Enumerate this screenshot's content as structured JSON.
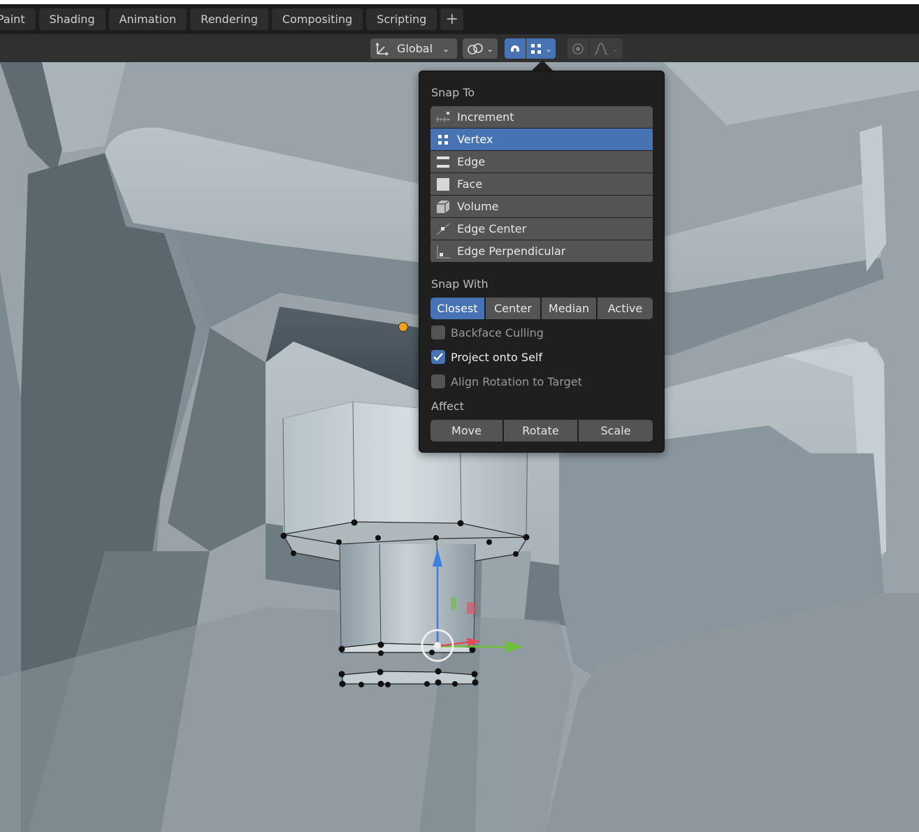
{
  "workspace_tabs": [
    "Paint",
    "Shading",
    "Animation",
    "Rendering",
    "Compositing",
    "Scripting"
  ],
  "workspace_add": "+",
  "header": {
    "orientation_label": "Global"
  },
  "snap_popover": {
    "snap_to_label": "Snap To",
    "snap_to_items": [
      {
        "label": "Increment",
        "icon": "increment-icon",
        "selected": false
      },
      {
        "label": "Vertex",
        "icon": "vertex-icon",
        "selected": true
      },
      {
        "label": "Edge",
        "icon": "edge-icon",
        "selected": false
      },
      {
        "label": "Face",
        "icon": "face-icon",
        "selected": false
      },
      {
        "label": "Volume",
        "icon": "volume-icon",
        "selected": false
      },
      {
        "label": "Edge Center",
        "icon": "edge-center-icon",
        "selected": false
      },
      {
        "label": "Edge Perpendicular",
        "icon": "edge-perpendicular-icon",
        "selected": false
      }
    ],
    "snap_with_label": "Snap With",
    "snap_with_options": [
      {
        "label": "Closest",
        "selected": true
      },
      {
        "label": "Center",
        "selected": false
      },
      {
        "label": "Median",
        "selected": false
      },
      {
        "label": "Active",
        "selected": false
      }
    ],
    "checkboxes": [
      {
        "label": "Backface Culling",
        "checked": false
      },
      {
        "label": "Project onto Self",
        "checked": true
      },
      {
        "label": "Align Rotation to Target",
        "checked": false
      }
    ],
    "affect_label": "Affect",
    "affect_options": [
      "Move",
      "Rotate",
      "Scale"
    ]
  },
  "colors": {
    "accent": "#4772b3",
    "popover_bg": "#1f1f1f",
    "button_bg": "#545454",
    "origin_dot": "#f0a020",
    "gizmo_z": "#3d7ee0",
    "gizmo_y": "#6cc03a",
    "gizmo_x": "#e24a5a"
  }
}
